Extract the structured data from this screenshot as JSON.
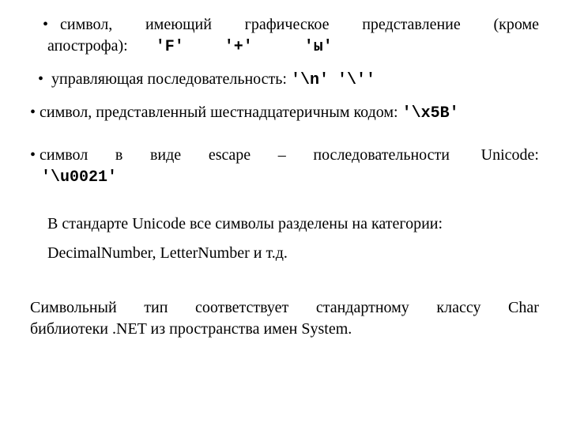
{
  "bullets": {
    "b1": {
      "lead": "•",
      "w1": "символ,",
      "w2": "имеющий",
      "w3": "графическое",
      "w4": "представление",
      "w5": "(кроме",
      "line2_text": "апострофа):",
      "code1": "'F'",
      "code2": "'+'",
      "code3": "'ы'"
    },
    "b2": {
      "lead": "•",
      "text": "управляющая последовательность:",
      "code1": "'\\n'",
      "code2": "'\\''"
    },
    "b3": {
      "lead": "•",
      "text": "символ, представленный шестнадцатеричным кодом:",
      "code1": "'\\x5B'"
    },
    "b4": {
      "lead": "•",
      "w1": "символ",
      "w2": "в",
      "w3": "виде",
      "w4": "escape",
      "w5": "–",
      "w6": "последовательности",
      "w7": "Unicode:",
      "code1": "'\\u0021'"
    }
  },
  "unicode_block": {
    "line1": "В стандарте Unicode все символы разделены на категории:",
    "line2": "DecimalNumber, LetterNumber и т.д."
  },
  "footer": {
    "w1": "Символьный",
    "w2": "тип",
    "w3": "соответствует",
    "w4": "стандартному",
    "w5": "классу",
    "w6": "Char",
    "line2": "библиотеки .NET из пространства имен System."
  }
}
